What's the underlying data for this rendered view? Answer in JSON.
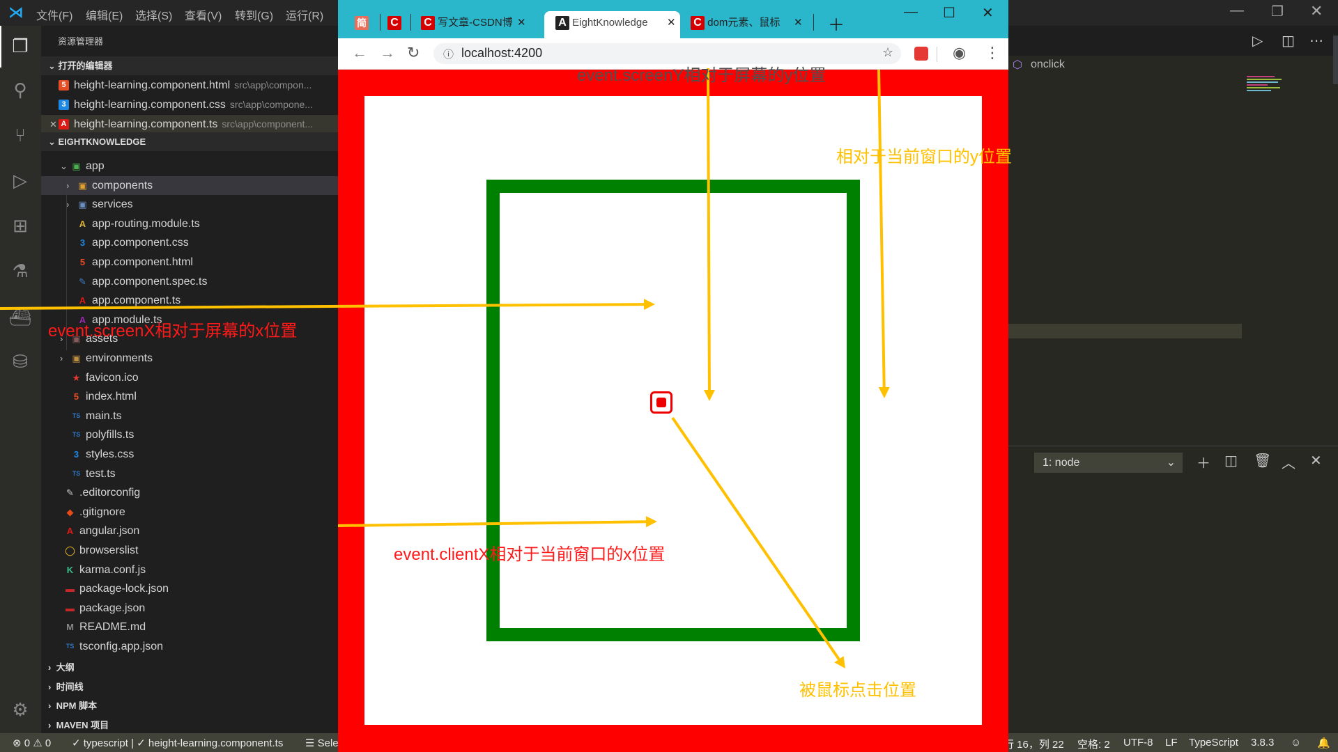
{
  "menu": [
    "文件(F)",
    "编辑(E)",
    "选择(S)",
    "查看(V)",
    "转到(G)",
    "运行(R)"
  ],
  "sidebar": {
    "title": "资源管理器",
    "open_editors_label": "打开的编辑器",
    "open_editors": [
      {
        "name": "height-learning.component.html",
        "path": "src\\app\\compon...",
        "icon": "html5-icon",
        "badge": "5",
        "color": "#e44d26"
      },
      {
        "name": "height-learning.component.css",
        "path": "src\\app\\compone...",
        "icon": "css3-icon",
        "badge": "3",
        "color": "#1e88e5"
      },
      {
        "name": "height-learning.component.ts",
        "path": "src\\app\\component...",
        "icon": "angular-icon",
        "badge": "A",
        "color": "#dd1b16"
      }
    ],
    "project_label": "EIGHTKNOWLEDGE",
    "tree": [
      {
        "name": "app",
        "depth": 1,
        "folder": true,
        "open": true,
        "badge": "▣",
        "color": "#4caf50"
      },
      {
        "name": "components",
        "depth": 2,
        "folder": true,
        "open": false,
        "badge": "▣",
        "color": "#e0a030",
        "selected": true
      },
      {
        "name": "services",
        "depth": 2,
        "folder": true,
        "open": false,
        "badge": "▣",
        "color": "#6a8fc0"
      },
      {
        "name": "app-routing.module.ts",
        "depth": 2,
        "badge": "A",
        "color": "#d8b43a"
      },
      {
        "name": "app.component.css",
        "depth": 2,
        "badge": "3",
        "color": "#1e88e5"
      },
      {
        "name": "app.component.html",
        "depth": 2,
        "badge": "5",
        "color": "#e44d26"
      },
      {
        "name": "app.component.spec.ts",
        "depth": 2,
        "badge": "✎",
        "color": "#3f7dc9"
      },
      {
        "name": "app.component.ts",
        "depth": 2,
        "badge": "A",
        "color": "#dd1b16"
      },
      {
        "name": "app.module.ts",
        "depth": 2,
        "badge": "A",
        "color": "#9c27b0"
      },
      {
        "name": "assets",
        "depth": 1,
        "folder": true,
        "open": false,
        "badge": "▣",
        "color": "#8a5a5a"
      },
      {
        "name": "environments",
        "depth": 1,
        "folder": true,
        "open": false,
        "badge": "▣",
        "color": "#c09040"
      },
      {
        "name": "favicon.ico",
        "depth": 1,
        "badge": "★",
        "color": "#e53935"
      },
      {
        "name": "index.html",
        "depth": 1,
        "badge": "5",
        "color": "#e44d26"
      },
      {
        "name": "main.ts",
        "depth": 1,
        "badge": "TS",
        "color": "#3178c6"
      },
      {
        "name": "polyfills.ts",
        "depth": 1,
        "badge": "TS",
        "color": "#3178c6"
      },
      {
        "name": "styles.css",
        "depth": 1,
        "badge": "3",
        "color": "#1e88e5"
      },
      {
        "name": "test.ts",
        "depth": 1,
        "badge": "TS",
        "color": "#3178c6"
      },
      {
        "name": ".editorconfig",
        "depth": 0,
        "badge": "✎",
        "color": "#cccccc"
      },
      {
        "name": ".gitignore",
        "depth": 0,
        "badge": "◆",
        "color": "#e64a19"
      },
      {
        "name": "angular.json",
        "depth": 0,
        "badge": "A",
        "color": "#dd1b16"
      },
      {
        "name": "browserslist",
        "depth": 0,
        "badge": "◯",
        "color": "#ffca28"
      },
      {
        "name": "karma.conf.js",
        "depth": 0,
        "badge": "K",
        "color": "#3cbe8c"
      },
      {
        "name": "package-lock.json",
        "depth": 0,
        "badge": "▬",
        "color": "#c62828"
      },
      {
        "name": "package.json",
        "depth": 0,
        "badge": "▬",
        "color": "#c62828"
      },
      {
        "name": "README.md",
        "depth": 0,
        "badge": "M",
        "color": "#888888"
      },
      {
        "name": "tsconfig.app.json",
        "depth": 0,
        "badge": "TS",
        "color": "#3178c6"
      }
    ],
    "bottom_sections": [
      "大纲",
      "时间线",
      "NPM 脚本",
      "MAVEN 项目"
    ]
  },
  "editor": {
    "breadcrumb": "onclick",
    "terminal_select": "1: node"
  },
  "statusbar": {
    "errors": "0",
    "warnings": "0",
    "lint": "✓ typescript | ✓ height-learning.component.ts",
    "selection": "Sele",
    "position": "行 16，列 22",
    "spaces": "空格: 2",
    "encoding": "UTF-8",
    "eol": "LF",
    "language": "TypeScript",
    "version": "3.8.3"
  },
  "browser": {
    "tabs": [
      {
        "title": "写文章-CSDN博"
      },
      {
        "title": "EightKnowledge",
        "active": true
      },
      {
        "title": "dom元素、鼠标"
      }
    ],
    "pinned_1": "简",
    "pinned_2": "C",
    "url": "localhost:4200",
    "accent": "#2ab6cb"
  },
  "annotations": {
    "screen_y": "event.screenY相对于屏幕的y位置",
    "client_y": "相对于当前窗口的y位置",
    "screen_x": "event.screenX相对于屏幕的x位置",
    "client_x": "event.clientX相对于当前窗口的x位置",
    "click_point": "被鼠标点击位置",
    "arrow_color": "#ffc000"
  }
}
